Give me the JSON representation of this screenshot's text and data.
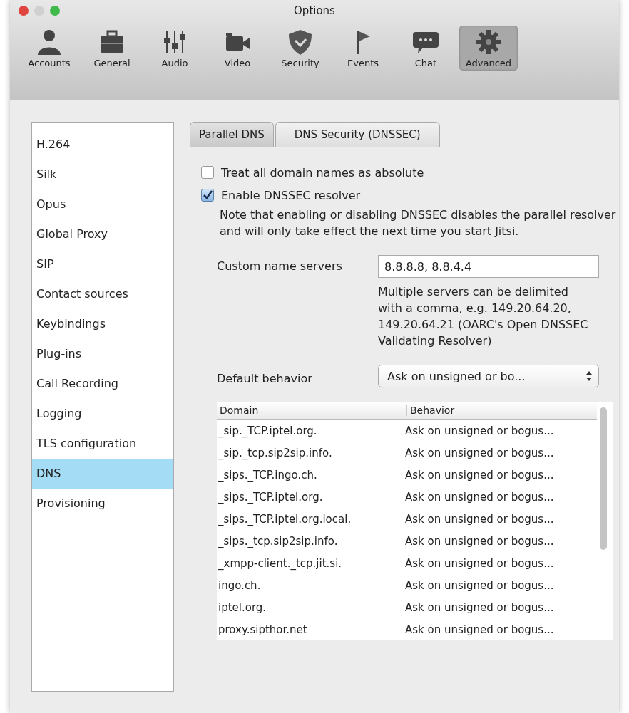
{
  "window": {
    "title": "Options"
  },
  "toolbar": [
    {
      "label": "Accounts",
      "kind": "person",
      "selected": false
    },
    {
      "label": "General",
      "kind": "briefcase",
      "selected": false
    },
    {
      "label": "Audio",
      "kind": "mixer",
      "selected": false
    },
    {
      "label": "Video",
      "kind": "camera",
      "selected": false
    },
    {
      "label": "Security",
      "kind": "shield",
      "selected": false
    },
    {
      "label": "Events",
      "kind": "flag",
      "selected": false
    },
    {
      "label": "Chat",
      "kind": "bubble",
      "selected": false
    },
    {
      "label": "Advanced",
      "kind": "gear",
      "selected": true
    }
  ],
  "sidebar": {
    "items": [
      {
        "label": "H.264",
        "selected": false
      },
      {
        "label": "Silk",
        "selected": false
      },
      {
        "label": "Opus",
        "selected": false
      },
      {
        "label": "Global Proxy",
        "selected": false
      },
      {
        "label": "SIP",
        "selected": false
      },
      {
        "label": "Contact sources",
        "selected": false
      },
      {
        "label": "Keybindings",
        "selected": false
      },
      {
        "label": "Plug-ins",
        "selected": false
      },
      {
        "label": "Call Recording",
        "selected": false
      },
      {
        "label": "Logging",
        "selected": false
      },
      {
        "label": "TLS configuration",
        "selected": false
      },
      {
        "label": "DNS",
        "selected": true
      },
      {
        "label": "Provisioning",
        "selected": false
      }
    ]
  },
  "tabs": [
    {
      "label": "Parallel DNS",
      "selected": false
    },
    {
      "label": "DNS Security (DNSSEC)",
      "selected": true
    }
  ],
  "options": [
    {
      "label": "Treat all domain names as absolute",
      "checked": false
    },
    {
      "label": "Enable DNSSEC resolver",
      "checked": true
    }
  ],
  "note": "Note that enabling or disabling DNSSEC disables the parallel resolver and will only take effect the next time you start Jitsi.",
  "custom_name_servers": {
    "label": "Custom name servers",
    "value": "8.8.8.8, 8.8.4.4",
    "hint": "Multiple servers can be delimited with a comma, e.g. 149.20.64.20, 149.20.64.21 (OARC's Open DNSSEC Validating Resolver)"
  },
  "default_behavior": {
    "label": "Default behavior",
    "value": "Ask on unsigned or bo..."
  },
  "table": {
    "columns": [
      "Domain",
      "Behavior"
    ],
    "rows": [
      [
        "_sip._TCP.iptel.org.",
        "Ask on unsigned or bogus..."
      ],
      [
        "_sip._tcp.sip2sip.info.",
        "Ask on unsigned or bogus..."
      ],
      [
        "_sips._TCP.ingo.ch.",
        "Ask on unsigned or bogus..."
      ],
      [
        "_sips._TCP.iptel.org.",
        "Ask on unsigned or bogus..."
      ],
      [
        "_sips._TCP.iptel.org.local.",
        "Ask on unsigned or bogus..."
      ],
      [
        "_sips._tcp.sip2sip.info.",
        "Ask on unsigned or bogus..."
      ],
      [
        "_xmpp-client._tcp.jit.si.",
        "Ask on unsigned or bogus..."
      ],
      [
        "ingo.ch.",
        "Ask on unsigned or bogus..."
      ],
      [
        "iptel.org.",
        "Ask on unsigned or bogus..."
      ],
      [
        "proxy.sipthor.net",
        "Ask on unsigned or bogus..."
      ]
    ]
  }
}
